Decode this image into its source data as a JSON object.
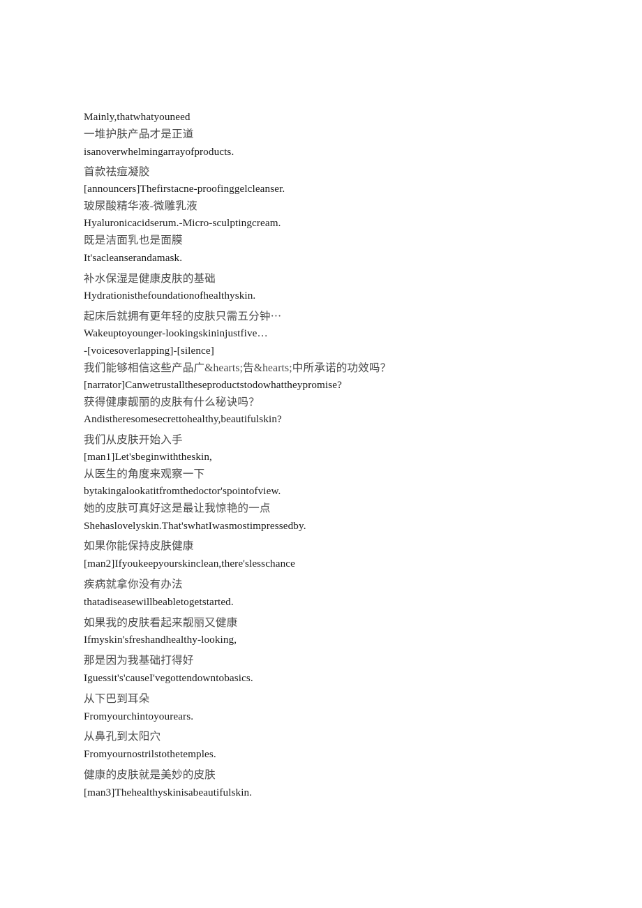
{
  "document": {
    "background_color": "#ffffff",
    "text_color_chinese": "#4a4a4a",
    "text_color_english": "#1a1a1a",
    "lines": [
      {
        "id": "l1",
        "lang": "en",
        "text": "Mainly,thatwhatyouneed"
      },
      {
        "id": "l2",
        "lang": "zh",
        "text": "一堆护肤产品才是正道"
      },
      {
        "id": "l3",
        "lang": "en",
        "text": "isanoverwhelmingarrayofproducts."
      },
      {
        "id": "l4",
        "lang": "zh",
        "text": "首款祛痘凝胶"
      },
      {
        "id": "l5",
        "lang": "en",
        "text": "[announcers]Thefirstacne-proofinggelcleanser."
      },
      {
        "id": "l6",
        "lang": "zh",
        "text": "玻尿酸精华液-微雕乳液"
      },
      {
        "id": "l7",
        "lang": "en",
        "text": "Hyaluronicacidserum.-Micro-sculptingcream."
      },
      {
        "id": "l8",
        "lang": "zh",
        "text": "既是洁面乳也是面膜"
      },
      {
        "id": "l9",
        "lang": "en",
        "text": "It'sacleanserandamask."
      },
      {
        "id": "l10",
        "lang": "zh",
        "text": "补水保湿是健康皮肤的基础"
      },
      {
        "id": "l11",
        "lang": "en",
        "text": "Hydrationisthefoundationofhealthyskin."
      },
      {
        "id": "l12",
        "lang": "zh",
        "text": "起床后就拥有更年轻的皮肤只需五分钟⋯"
      },
      {
        "id": "l13",
        "lang": "en",
        "text": "Wakeuptoyounger-lookingskininjustfive…"
      },
      {
        "id": "l14",
        "lang": "en",
        "text": "-[voicesoverlapping]-[silence]"
      },
      {
        "id": "l15",
        "lang": "zh",
        "text": "我们能够相信这些产品广&hearts;告&hearts;中所承诺的功效吗？"
      },
      {
        "id": "l16",
        "lang": "en",
        "text": "[narrator]Canwetrustalltheseproductstodowhattheypromise?"
      },
      {
        "id": "l17",
        "lang": "zh",
        "text": "获得健康靓丽的皮肤有什么秘诀吗？"
      },
      {
        "id": "l18",
        "lang": "en",
        "text": "Andistheresomesecrettohealthy,beautifulskin?"
      },
      {
        "id": "l19",
        "lang": "zh",
        "text": "我们从皮肤开始入手"
      },
      {
        "id": "l20",
        "lang": "en",
        "text": "[man1]Let'sbeginwiththeskin,"
      },
      {
        "id": "l21",
        "lang": "zh",
        "text": "从医生的角度来观察一下"
      },
      {
        "id": "l22",
        "lang": "en",
        "text": "bytakingalookatitfromthedoctor'spointofview."
      },
      {
        "id": "l23",
        "lang": "zh",
        "text": "她的皮肤可真好这是最让我惊艳的一点"
      },
      {
        "id": "l24",
        "lang": "en",
        "text": "Shehaslovelyskin.That'swhatIwasmostimpressedby."
      },
      {
        "id": "l25",
        "lang": "zh",
        "text": "如果你能保持皮肤健康"
      },
      {
        "id": "l26",
        "lang": "en",
        "text": "[man2]Ifyoukeepyourskinclean,there'slesschance"
      },
      {
        "id": "l27",
        "lang": "zh",
        "text": "疾病就拿你没有办法"
      },
      {
        "id": "l28",
        "lang": "en",
        "text": "thatadiseasewillbeabletogetstarted."
      },
      {
        "id": "l29",
        "lang": "zh",
        "text": "如果我的皮肤看起来靓丽又健康"
      },
      {
        "id": "l30",
        "lang": "en",
        "text": "Ifmyskin'sfreshandhealthy-looking,"
      },
      {
        "id": "l31",
        "lang": "zh",
        "text": "那是因为我基础打得好"
      },
      {
        "id": "l32",
        "lang": "en",
        "text": "Iguessit's'causeI'vegottendowntobasics."
      },
      {
        "id": "l33",
        "lang": "zh",
        "text": "从下巴到耳朵"
      },
      {
        "id": "l34",
        "lang": "en",
        "text": "Fromyourchintoyourears."
      },
      {
        "id": "l35",
        "lang": "zh",
        "text": "从鼻孔到太阳穴"
      },
      {
        "id": "l36",
        "lang": "en",
        "text": "Fromyournostrilstothetemples."
      },
      {
        "id": "l37",
        "lang": "zh",
        "text": "健康的皮肤就是美妙的皮肤"
      },
      {
        "id": "l38",
        "lang": "en",
        "text": "[man3]Thehealthyskinisabeautifulskin."
      }
    ],
    "groups": [
      {
        "tight": false,
        "line_ids": [
          "l1",
          "l2",
          "l3"
        ]
      },
      {
        "tight": true,
        "line_ids": [
          "l4",
          "l5"
        ]
      },
      {
        "tight": true,
        "line_ids": [
          "l6",
          "l7"
        ]
      },
      {
        "tight": false,
        "line_ids": [
          "l8",
          "l9"
        ]
      },
      {
        "tight": false,
        "line_ids": [
          "l10",
          "l11"
        ]
      },
      {
        "tight": true,
        "line_ids": [
          "l12",
          "l13",
          "l14"
        ]
      },
      {
        "tight": true,
        "line_ids": [
          "l15",
          "l16"
        ]
      },
      {
        "tight": false,
        "line_ids": [
          "l17",
          "l18"
        ]
      },
      {
        "tight": true,
        "line_ids": [
          "l19",
          "l20"
        ]
      },
      {
        "tight": true,
        "line_ids": [
          "l21",
          "l22"
        ]
      },
      {
        "tight": false,
        "line_ids": [
          "l23",
          "l24"
        ]
      },
      {
        "tight": false,
        "line_ids": [
          "l25",
          "l26"
        ]
      },
      {
        "tight": false,
        "line_ids": [
          "l27",
          "l28"
        ]
      },
      {
        "tight": false,
        "line_ids": [
          "l29",
          "l30"
        ]
      },
      {
        "tight": false,
        "line_ids": [
          "l31",
          "l32"
        ]
      },
      {
        "tight": false,
        "line_ids": [
          "l33",
          "l34"
        ]
      },
      {
        "tight": false,
        "line_ids": [
          "l35",
          "l36"
        ]
      },
      {
        "tight": false,
        "line_ids": [
          "l37",
          "l38"
        ]
      }
    ]
  }
}
